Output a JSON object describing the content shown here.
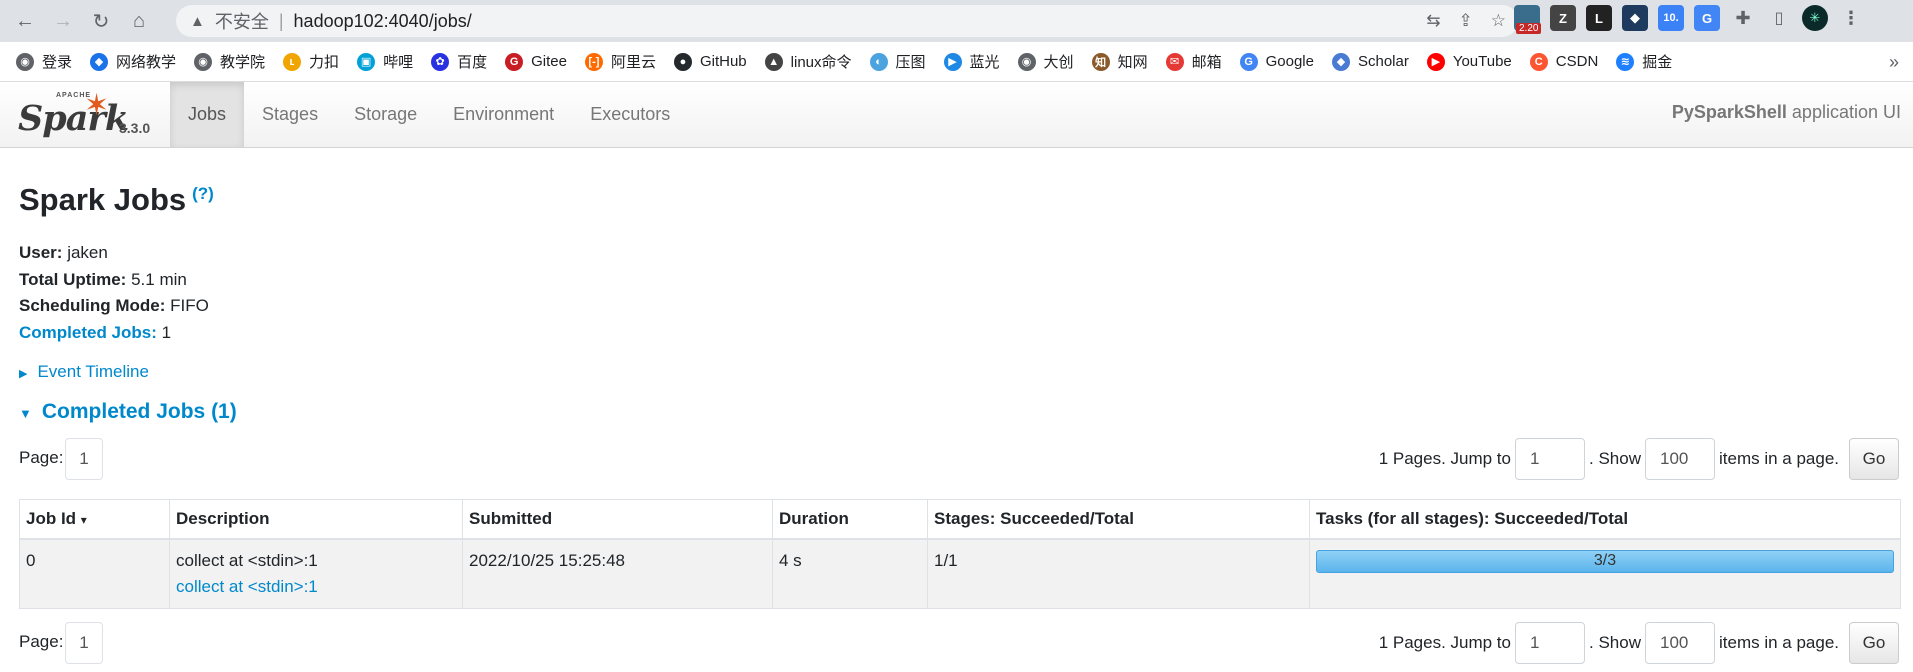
{
  "browser": {
    "address": {
      "warning": "不安全",
      "url": "hadoop102:4040/jobs/"
    },
    "extensions": [
      {
        "label": "",
        "badge": "2.20",
        "color": "#3a6d8c"
      },
      {
        "label": "Z",
        "badge": "",
        "color": "#444444"
      },
      {
        "label": "L",
        "badge": "",
        "color": "#222222"
      },
      {
        "label": "◆",
        "badge": "",
        "color": "#1e3a5f"
      },
      {
        "label": "10.",
        "badge": "",
        "color": "#3b82f6"
      },
      {
        "label": "G",
        "badge": "",
        "color": "#4285f4"
      }
    ],
    "bookmarks": [
      {
        "label": "登录",
        "icon": "globe-icon",
        "color": "#5f6368"
      },
      {
        "label": "网络教学",
        "icon": "diamond-icon",
        "color": "#1a73e8"
      },
      {
        "label": "教学院",
        "icon": "globe-icon",
        "color": "#5f6368"
      },
      {
        "label": "力扣",
        "icon": "leetcode-icon",
        "color": "#f0a500"
      },
      {
        "label": "哔哩",
        "icon": "bilibili-icon",
        "color": "#00a1d6"
      },
      {
        "label": "百度",
        "icon": "baidu-icon",
        "color": "#2932e1"
      },
      {
        "label": "Gitee",
        "icon": "gitee-icon",
        "color": "#c71d23"
      },
      {
        "label": "阿里云",
        "icon": "aliyun-icon",
        "color": "#ff6a00"
      },
      {
        "label": "GitHub",
        "icon": "github-icon",
        "color": "#24292e"
      },
      {
        "label": "linux命令",
        "icon": "linux-icon",
        "color": "#444444"
      },
      {
        "label": "压图",
        "icon": "compress-icon",
        "color": "#4aa3df"
      },
      {
        "label": "蓝光",
        "icon": "play-icon",
        "color": "#1e88e5"
      },
      {
        "label": "大创",
        "icon": "globe-icon",
        "color": "#5f6368"
      },
      {
        "label": "知网",
        "icon": "cnki-icon",
        "color": "#8b5a2b"
      },
      {
        "label": "邮箱",
        "icon": "mail-icon",
        "color": "#e53935"
      },
      {
        "label": "Google",
        "icon": "google-icon",
        "color": "#4285f4"
      },
      {
        "label": "Scholar",
        "icon": "scholar-icon",
        "color": "#4a7bd3"
      },
      {
        "label": "YouTube",
        "icon": "youtube-icon",
        "color": "#ff0000"
      },
      {
        "label": "CSDN",
        "icon": "csdn-icon",
        "color": "#fc5531"
      },
      {
        "label": "掘金",
        "icon": "juejin-icon",
        "color": "#1e80ff"
      }
    ]
  },
  "navbar": {
    "brand_apache": "APACHE",
    "brand_name": "Spark",
    "version": "3.3.0",
    "tabs": [
      "Jobs",
      "Stages",
      "Storage",
      "Environment",
      "Executors"
    ],
    "active_tab": "Jobs",
    "app_name": "PySparkShell",
    "app_suffix": "application UI"
  },
  "page": {
    "title": "Spark Jobs",
    "help": "(?)",
    "user_label": "User:",
    "user": "jaken",
    "uptime_label": "Total Uptime:",
    "uptime": "5.1 min",
    "mode_label": "Scheduling Mode:",
    "mode": "FIFO",
    "completed_label": "Completed Jobs:",
    "completed_count": "1",
    "event_timeline": "Event Timeline",
    "completed_header": "Completed Jobs (1)"
  },
  "pager": {
    "page_label": "Page:",
    "current_page": "1",
    "pages_text": "1 Pages. Jump to",
    "jump_value": "1",
    "show_text": ". Show",
    "show_value": "100",
    "items_text": "items in a page.",
    "go_label": "Go"
  },
  "table": {
    "sort_indicator": "▾",
    "columns": [
      "Job Id",
      "Description",
      "Submitted",
      "Duration",
      "Stages: Succeeded/Total",
      "Tasks (for all stages): Succeeded/Total"
    ],
    "rows": [
      {
        "job_id": "0",
        "description": "collect at <stdin>:1",
        "description_link": "collect at <stdin>:1",
        "submitted": "2022/10/25 15:25:48",
        "duration": "4 s",
        "stages": "1/1",
        "tasks": "3/3",
        "tasks_fraction": 1.0
      }
    ]
  },
  "colors": {
    "link": "#0088cc",
    "spark_orange": "#e25a1c"
  }
}
